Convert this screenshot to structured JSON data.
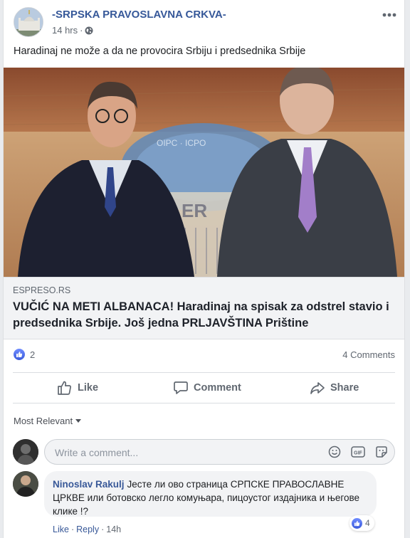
{
  "post": {
    "page_name": "-SRPSKA PRAVOSLAVNA CRKVA-",
    "time": "14 hrs",
    "audience_icon": "globe-icon",
    "text": "Haradinaj ne može a da ne provocira Srbiju i predsednika Srbije"
  },
  "link": {
    "domain": "ESPRESO.RS",
    "title": "VUČIĆ NA METI ALBANACA! Haradinaj na spisak za odstrel stavio i predsednika Srbije. Još jedna PRLJAVŠTINA Prištine"
  },
  "stats": {
    "reaction_count": "2",
    "comments": "4 Comments"
  },
  "actions": {
    "like": "Like",
    "comment": "Comment",
    "share": "Share"
  },
  "comments_section": {
    "sort_label": "Most Relevant",
    "input_placeholder": "Write a comment...",
    "gif_label": "GIF",
    "items": [
      {
        "author": "Ninoslav Rakulj",
        "text": "Јесте ли ово страница СРПСКЕ ПРАВОСЛАВНЕ ЦРКВЕ или ботовско легло комуњара, пицоустог издајника и његове клике !?",
        "reactions": "4",
        "like": "Like",
        "reply": "Reply",
        "time": "14h"
      }
    ]
  },
  "colors": {
    "link_blue": "#365899",
    "like_blue": "#3b5bdb",
    "meta_gray": "#606770"
  }
}
